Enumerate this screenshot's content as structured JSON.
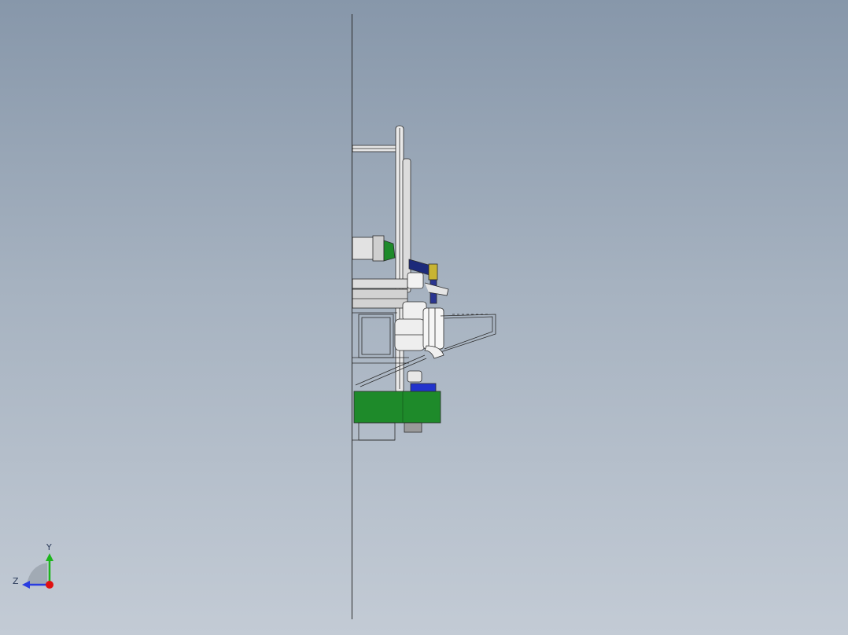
{
  "viewport": {
    "background_top": "#8797aa",
    "background_bottom": "#c3cbd5"
  },
  "model": {
    "view": "right side view",
    "colors": {
      "frame_line": "#2b2b2b",
      "metal": "#d8d8d8",
      "green_part": "#1e8a2a",
      "blue_part": "#2233cc",
      "navy_part": "#1c2a7a",
      "yellow_part": "#c8b432"
    }
  },
  "triad": {
    "y_label": "Y",
    "z_label": "Z",
    "icon": "coordinate-triad-icon",
    "y_color": "#1db51d",
    "z_color": "#2a3de0",
    "x_color": "#e01010"
  }
}
